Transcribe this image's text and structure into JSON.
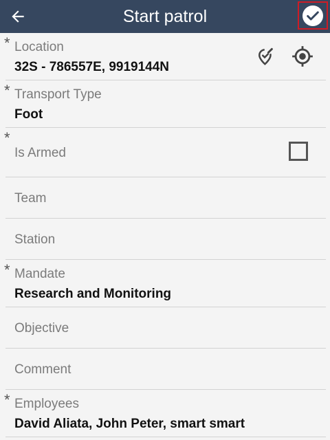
{
  "header": {
    "title": "Start patrol",
    "back_icon": "arrow-left-icon",
    "confirm_icon": "check-circle-icon"
  },
  "fields": {
    "location": {
      "required": "*",
      "label": "Location",
      "value": "32S - 786557E, 9919144N",
      "edit_icon": "map-pin-edit-icon",
      "gps_icon": "gps-target-icon"
    },
    "transport": {
      "required": "*",
      "label": "Transport Type",
      "value": "Foot"
    },
    "armed": {
      "required": "*",
      "label": "Is Armed",
      "checked": false
    },
    "team": {
      "label": "Team"
    },
    "station": {
      "label": "Station"
    },
    "mandate": {
      "required": "*",
      "label": "Mandate",
      "value": "Research and Monitoring"
    },
    "objective": {
      "label": "Objective"
    },
    "comment": {
      "label": "Comment"
    },
    "employees": {
      "required": "*",
      "label": "Employees",
      "value": "David Aliata, John Peter, smart smart"
    }
  },
  "colors": {
    "header_bg": "#36475f",
    "page_bg": "#f4f4f4",
    "highlight_border": "#d01c25"
  }
}
